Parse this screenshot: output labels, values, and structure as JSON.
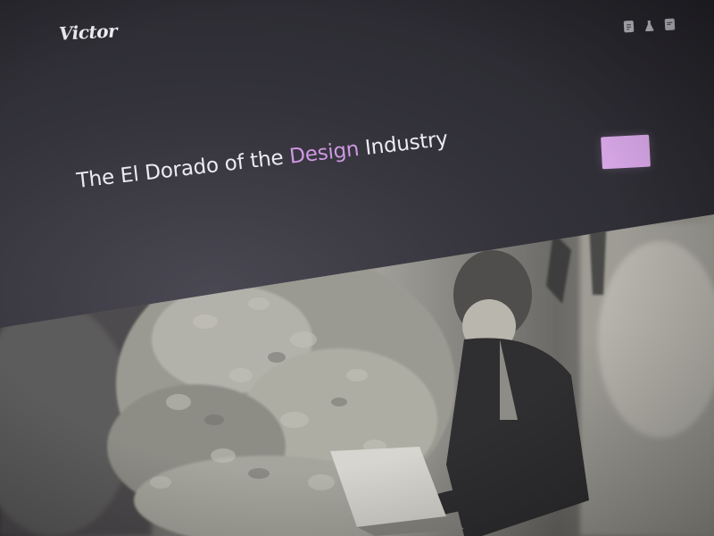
{
  "header": {
    "logo": "Victor",
    "icons": [
      "document-icon",
      "flask-icon",
      "chat-icon"
    ]
  },
  "hero": {
    "headline_part1": "The El Dorado of the ",
    "headline_accent": "Design",
    "headline_part2": " Industry",
    "cta_label": ""
  },
  "colors": {
    "background": "#2f2e35",
    "accent": "#cf98e3",
    "button": "#d7a6e6",
    "text": "#ecebef"
  }
}
